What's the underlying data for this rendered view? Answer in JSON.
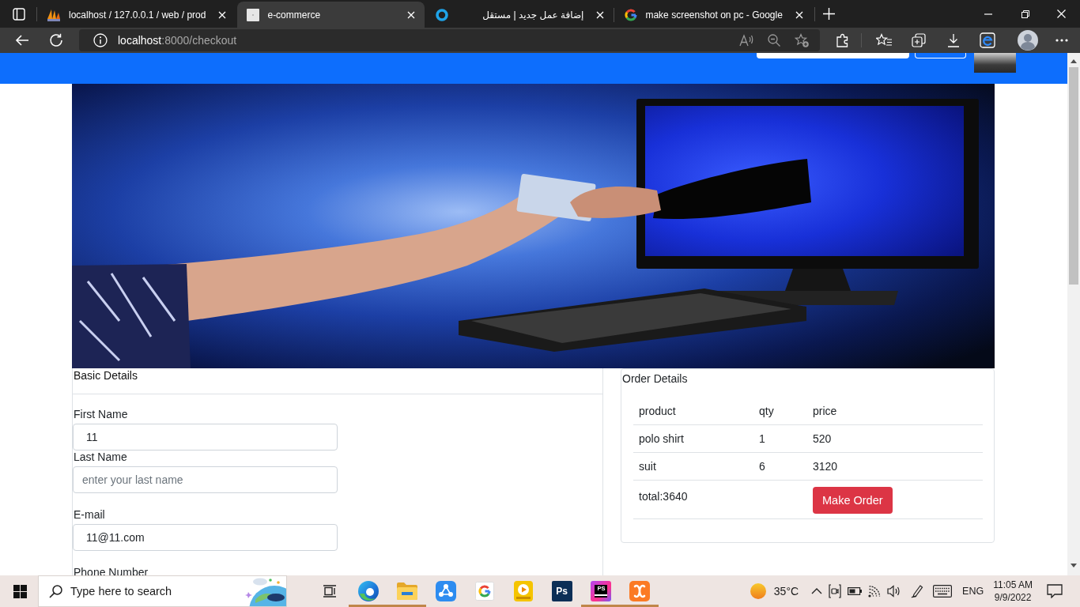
{
  "browser": {
    "tabs": [
      {
        "kind": "pma",
        "title": "localhost / 127.0.0.1 / web / prod",
        "selected": false
      },
      {
        "kind": "page",
        "title": "e-commerce",
        "selected": true
      },
      {
        "kind": "ring",
        "title": "إضافة عمل جديد | مستقل",
        "selected": false
      },
      {
        "kind": "g",
        "title": "make screenshot on pc - Google",
        "selected": false
      }
    ],
    "address": {
      "host": "localhost",
      "path": ":8000/checkout"
    }
  },
  "basic_details": {
    "title": "Basic Details",
    "fields": [
      {
        "label": "First Name",
        "value": "11"
      },
      {
        "label": "Last Name",
        "placeholder": "enter your last name"
      },
      {
        "label": "E-mail",
        "value": "11@11.com"
      },
      {
        "label": "Phone Number"
      }
    ]
  },
  "order_details": {
    "title": "Order Details",
    "columns": [
      "product",
      "qty",
      "price"
    ],
    "rows": [
      [
        "polo shirt",
        "1",
        "520"
      ],
      [
        "suit",
        "6",
        "3120"
      ]
    ],
    "total": "total:3640",
    "button": "Make Order"
  },
  "taskbar": {
    "search": {
      "placeholder": "Type here to search"
    },
    "apps": [
      {
        "kind": "edge",
        "running": true
      },
      {
        "kind": "files",
        "running": true
      },
      {
        "kind": "share",
        "running": false
      },
      {
        "kind": "g",
        "running": false
      },
      {
        "kind": "player",
        "running": false
      },
      {
        "kind": "ps",
        "badge": "Ps",
        "running": false
      },
      {
        "kind": "phpstorm",
        "badge": "PS",
        "running": true
      },
      {
        "kind": "xampp",
        "running": true
      }
    ],
    "weather": "35°C",
    "language": "ENG",
    "time": "11:05 AM",
    "date": "9/9/2022"
  }
}
